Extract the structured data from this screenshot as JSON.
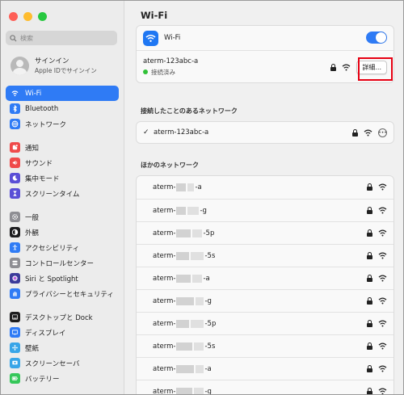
{
  "window": {
    "traffic_colors": [
      "#fe5f57",
      "#febc2e",
      "#28c840"
    ]
  },
  "sidebar": {
    "search_placeholder": "検索",
    "account": {
      "name": "サインイン",
      "sub": "Apple IDでサインイン"
    },
    "items": [
      {
        "label": "Wi-Fi",
        "icon": "wifi-icon",
        "color": "#2f7bf5",
        "selected": true
      },
      {
        "label": "Bluetooth",
        "icon": "bluetooth-icon",
        "color": "#2f7bf5"
      },
      {
        "label": "ネットワーク",
        "icon": "globe-icon",
        "color": "#2f7bf5"
      },
      {
        "label": "通知",
        "icon": "notification-icon",
        "color": "#ef4a4a"
      },
      {
        "label": "サウンド",
        "icon": "speaker-icon",
        "color": "#ef4a4a"
      },
      {
        "label": "集中モード",
        "icon": "moon-icon",
        "color": "#5a4fd6"
      },
      {
        "label": "スクリーンタイム",
        "icon": "hourglass-icon",
        "color": "#5a4fd6"
      },
      {
        "label": "一般",
        "icon": "gear-icon",
        "color": "#8e8e93"
      },
      {
        "label": "外観",
        "icon": "appearance-icon",
        "color": "#1c1c1e"
      },
      {
        "label": "アクセシビリティ",
        "icon": "accessibility-icon",
        "color": "#2f7bf5"
      },
      {
        "label": "コントロールセンター",
        "icon": "control-center-icon",
        "color": "#8e8e93"
      },
      {
        "label": "Siri と Spotlight",
        "icon": "siri-icon",
        "color": "#3b3b9a"
      },
      {
        "label": "プライバシーとセキュリティ",
        "icon": "hand-icon",
        "color": "#2f7bf5"
      },
      {
        "label": "デスクトップと Dock",
        "icon": "dock-icon",
        "color": "#1c1c1e"
      },
      {
        "label": "ディスプレイ",
        "icon": "display-icon",
        "color": "#2f7bf5"
      },
      {
        "label": "壁紙",
        "icon": "wallpaper-icon",
        "color": "#38a5e8"
      },
      {
        "label": "スクリーンセーバ",
        "icon": "screensaver-icon",
        "color": "#38a5e8"
      },
      {
        "label": "バッテリー",
        "icon": "battery-icon",
        "color": "#35c759"
      }
    ]
  },
  "main": {
    "title": "Wi-Fi",
    "wifi_label": "Wi-Fi",
    "current": {
      "ssid": "aterm-123abc-a",
      "status": "接続済み",
      "details_label": "詳細..."
    },
    "known_header": "接続したことのあるネットワーク",
    "known": [
      {
        "ssid": "aterm-123abc-a"
      }
    ],
    "other_header": "ほかのネットワーク",
    "others": [
      {
        "prefix": "aterm-",
        "suffix": "a"
      },
      {
        "prefix": "aterm-",
        "suffix": "g"
      },
      {
        "prefix": "aterm-",
        "suffix": "5p"
      },
      {
        "prefix": "aterm-",
        "suffix": "5s"
      },
      {
        "prefix": "aterm-",
        "suffix": "a"
      },
      {
        "prefix": "aterm-",
        "suffix": "g"
      },
      {
        "prefix": "aterm-",
        "suffix": "5p"
      },
      {
        "prefix": "aterm-",
        "suffix": "5s"
      },
      {
        "prefix": "aterm-",
        "suffix": "a"
      },
      {
        "prefix": "aterm-",
        "suffix": "g"
      }
    ]
  }
}
